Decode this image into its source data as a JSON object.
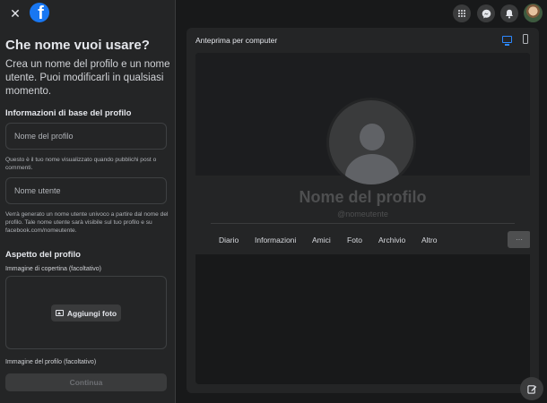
{
  "header": {
    "close_icon": "close-icon",
    "logo_icon": "facebook-logo",
    "logo_letter": "f"
  },
  "form": {
    "title": "Che nome vuoi usare?",
    "subtitle": "Crea un nome del profilo e un nome utente. Puoi modificarli in qualsiasi momento.",
    "basic_info_title": "Informazioni di base del profilo",
    "profile_name_placeholder": "Nome del profilo",
    "profile_name_help": "Questo è il tuo nome visualizzato quando pubblichi post o commenti.",
    "username_placeholder": "Nome utente",
    "username_help": "Verrà generato un nome utente univoco a partire dal nome del profilo. Tale nome utente sarà visibile sul tuo profilo e su facebook.com/nomeutente.",
    "appearance_title": "Aspetto del profilo",
    "cover_label": "Immagine di copertina (facoltativo)",
    "add_photo_label": "Aggiungi foto",
    "profile_image_label": "Immagine del profilo (facoltativo)",
    "continue_label": "Continua"
  },
  "topbar_right": {
    "icons": [
      "menu-grid-icon",
      "messenger-icon",
      "notifications-bell-icon",
      "account-avatar"
    ]
  },
  "preview": {
    "title": "Anteprima per computer",
    "desktop_icon": "desktop-icon",
    "mobile_icon": "mobile-icon",
    "profile_name": "Nome del profilo",
    "username": "@nomeutente",
    "tabs": [
      "Diario",
      "Informazioni",
      "Amici",
      "Foto",
      "Archivio",
      "Altro"
    ],
    "more_label": "···"
  },
  "colors": {
    "accent": "#2d88ff",
    "brand": "#1877f2",
    "background": "#18191a",
    "surface": "#242526"
  }
}
